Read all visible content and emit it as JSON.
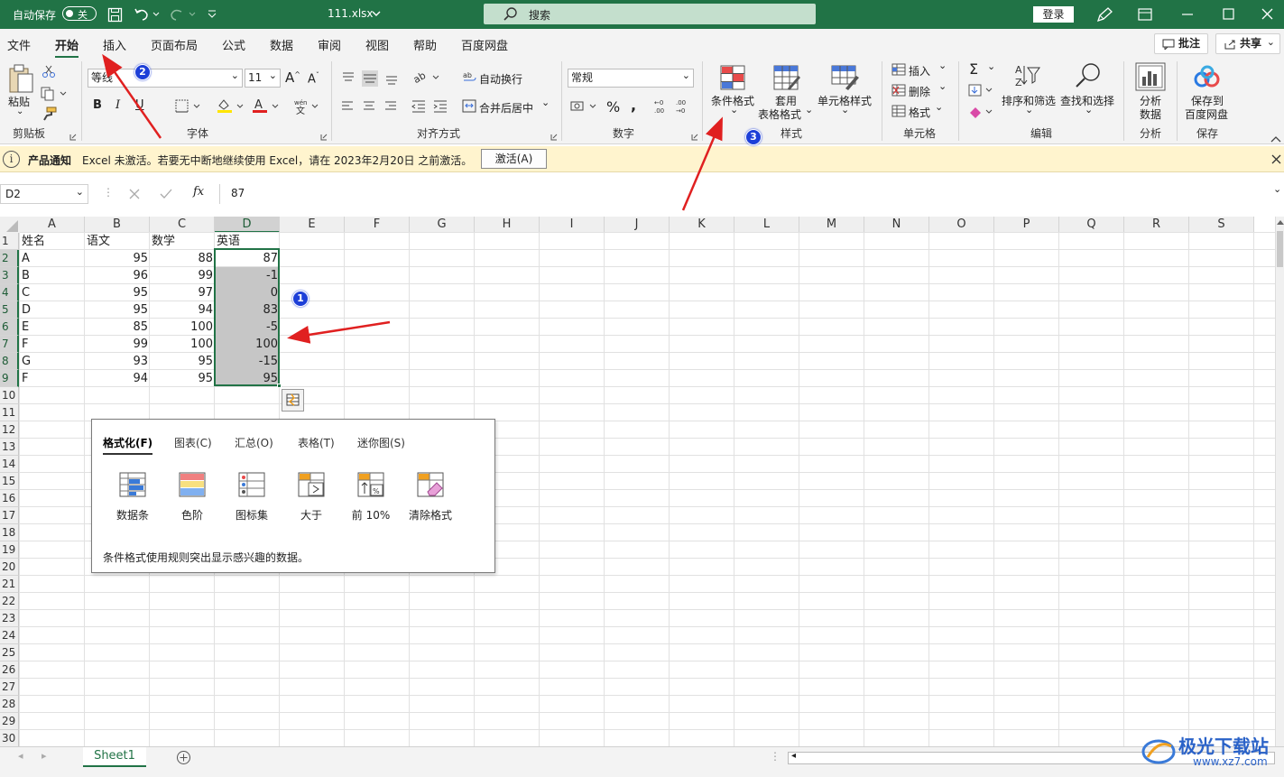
{
  "titlebar": {
    "autosave_label": "自动保存",
    "autosave_state": "关",
    "filename": "111.xlsx",
    "search_placeholder": "搜索",
    "login": "登录"
  },
  "menu": {
    "tabs": [
      "文件",
      "开始",
      "插入",
      "页面布局",
      "公式",
      "数据",
      "审阅",
      "视图",
      "帮助",
      "百度网盘"
    ],
    "active_tab": "开始",
    "comments_button": "批注",
    "share_button": "共享"
  },
  "ribbon": {
    "clipboard": {
      "paste": "粘贴",
      "group": "剪贴板"
    },
    "font": {
      "name": "等线",
      "size": "11",
      "group": "字体"
    },
    "alignment": {
      "wrap": "自动换行",
      "merge": "合并后居中",
      "group": "对齐方式"
    },
    "number": {
      "format": "常规",
      "group": "数字"
    },
    "styles": {
      "conditional": "条件格式",
      "table1": "套用",
      "table2": "表格格式",
      "cellstyles": "单元格样式",
      "group": "样式"
    },
    "cells": {
      "insert": "插入",
      "delete": "删除",
      "format": "格式",
      "group": "单元格"
    },
    "editing": {
      "sort": "排序和筛选",
      "find": "查找和选择",
      "group": "编辑"
    },
    "analysis": {
      "analyze1": "分析",
      "analyze2": "数据",
      "group": "分析"
    },
    "save": {
      "save1": "保存到",
      "save2": "百度网盘",
      "group": "保存"
    }
  },
  "notification": {
    "title": "产品通知",
    "message": "Excel 未激活。若要无中断地继续使用 Excel，请在 2023年2月20日 之前激活。",
    "button": "激活(A)"
  },
  "formula_bar": {
    "name_box": "D2",
    "value": "87"
  },
  "columns": [
    "A",
    "B",
    "C",
    "D",
    "E",
    "F",
    "G",
    "H",
    "I",
    "J",
    "K",
    "L",
    "M",
    "N",
    "O",
    "P",
    "Q",
    "R",
    "S"
  ],
  "selected_column": "D",
  "rows": [
    "1",
    "2",
    "3",
    "4",
    "5",
    "6",
    "7",
    "8",
    "9",
    "10",
    "11",
    "12",
    "13",
    "14",
    "15",
    "16",
    "17",
    "18",
    "19",
    "20",
    "21",
    "22",
    "23",
    "24",
    "25",
    "26",
    "27",
    "28",
    "29",
    "30"
  ],
  "table": {
    "headers": [
      "姓名",
      "语文",
      "数学",
      "英语"
    ],
    "data": [
      [
        "A",
        "95",
        "88",
        "87"
      ],
      [
        "B",
        "96",
        "99",
        "-1"
      ],
      [
        "C",
        "95",
        "97",
        "0"
      ],
      [
        "D",
        "95",
        "94",
        "83"
      ],
      [
        "E",
        "85",
        "100",
        "-5"
      ],
      [
        "F",
        "99",
        "100",
        "100"
      ],
      [
        "G",
        "93",
        "95",
        "-15"
      ],
      [
        "F",
        "94",
        "95",
        "95"
      ]
    ]
  },
  "quick_analysis": {
    "tabs": [
      "格式化(F)",
      "图表(C)",
      "汇总(O)",
      "表格(T)",
      "迷你图(S)"
    ],
    "items": [
      "数据条",
      "色阶",
      "图标集",
      "大于",
      "前 10%",
      "清除格式"
    ],
    "description": "条件格式使用规则突出显示感兴趣的数据。"
  },
  "sheet_tab": "Sheet1",
  "annotations": [
    "1",
    "2",
    "3"
  ],
  "watermark": {
    "text": "极光下载站",
    "url": "www.xz7.com"
  },
  "colors": {
    "excel_green": "#217346",
    "arrow_red": "#e02020",
    "badge_blue": "#1d3fd8"
  }
}
